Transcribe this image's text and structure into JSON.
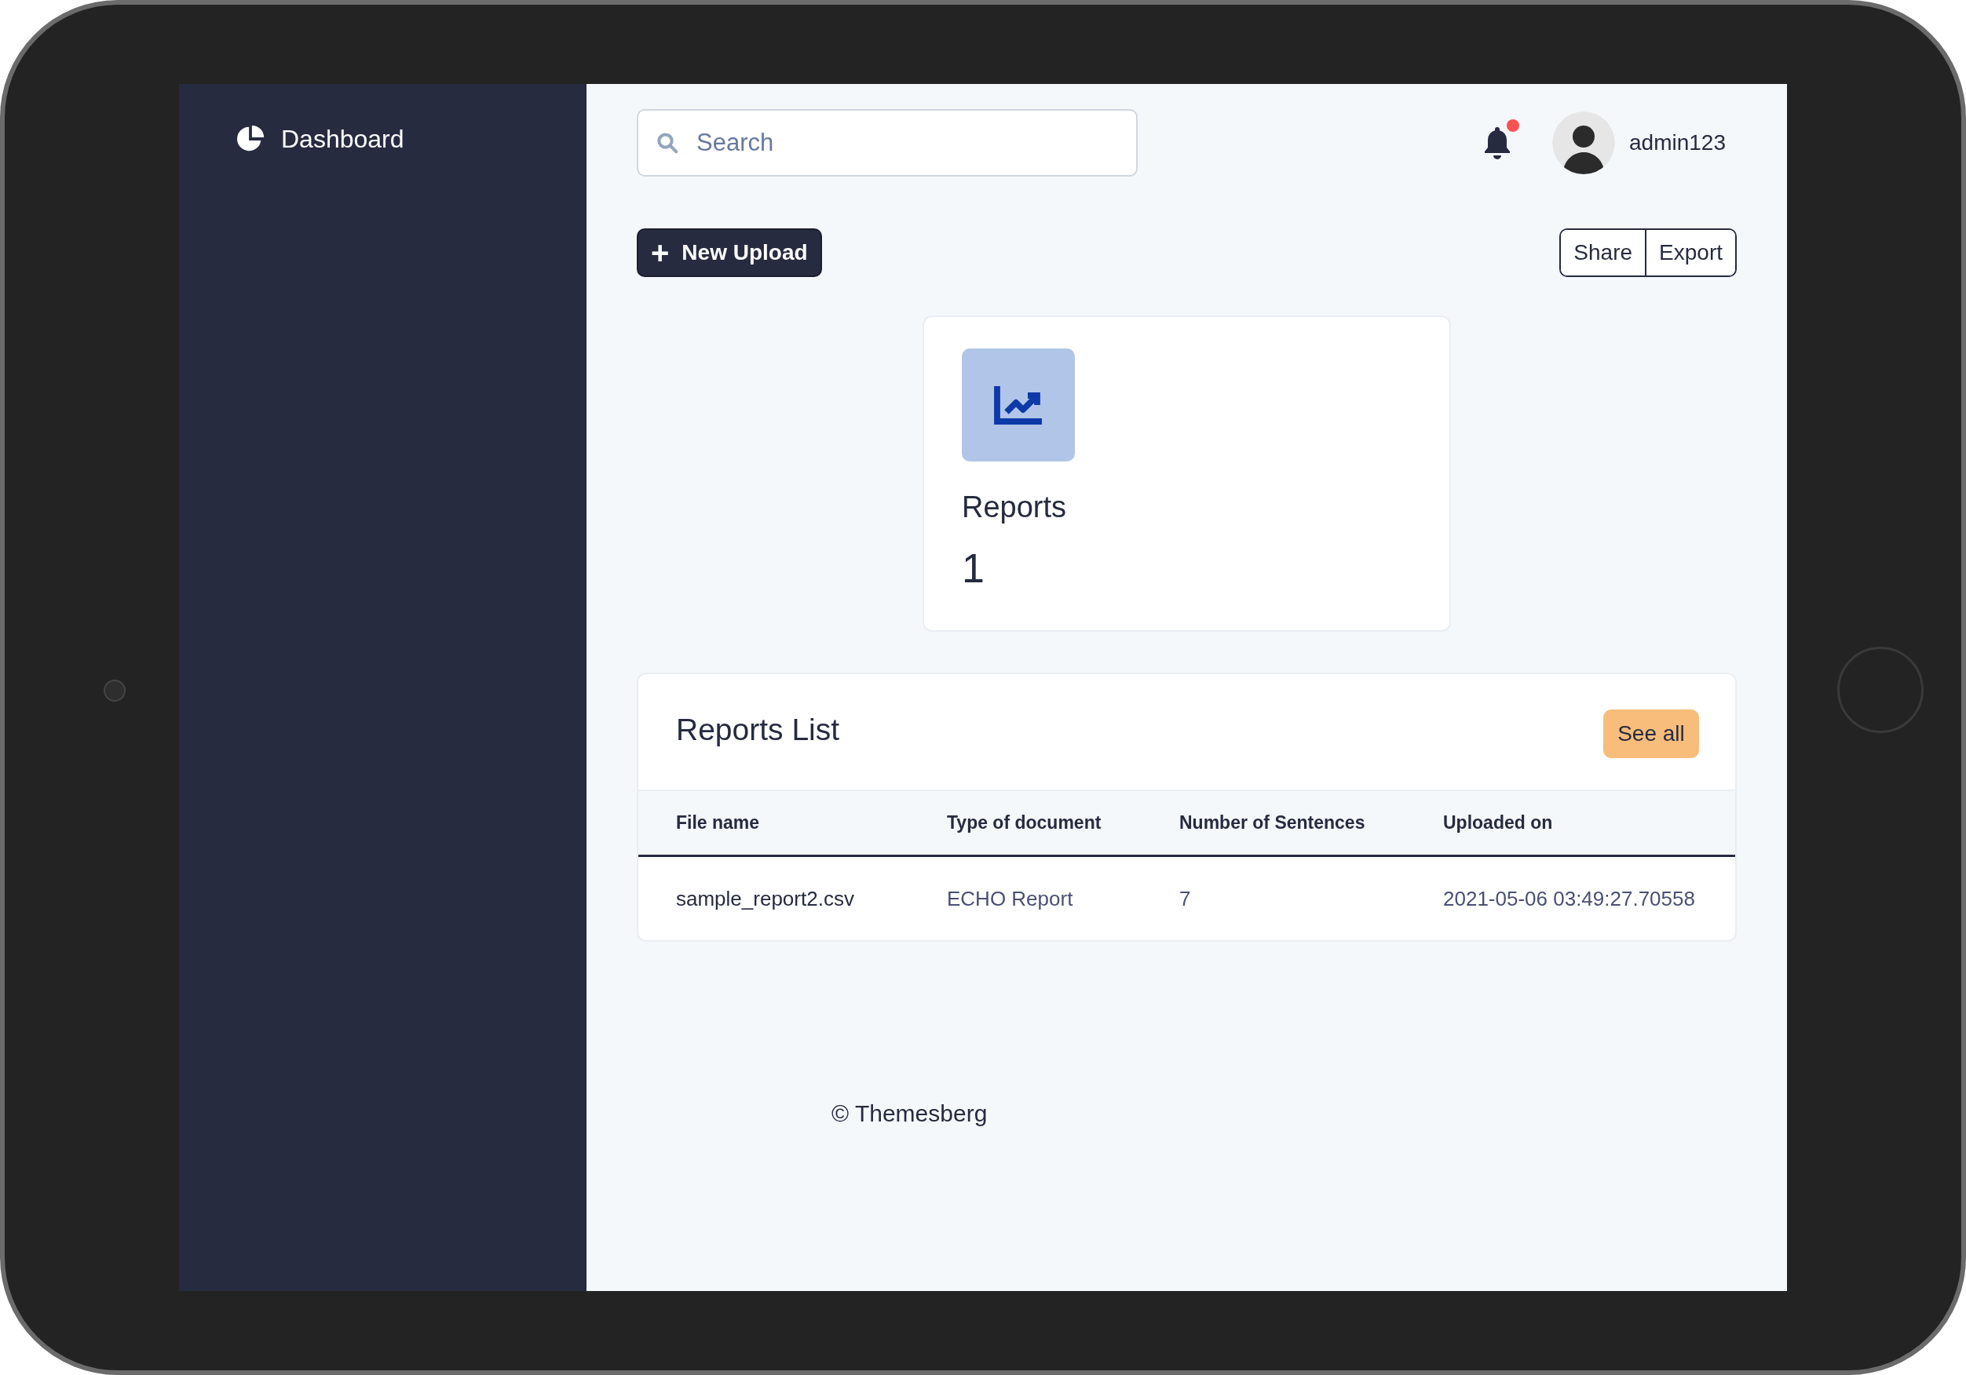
{
  "sidebar": {
    "brand": "Dashboard"
  },
  "topbar": {
    "search": {
      "placeholder": "Search"
    },
    "notifications": {
      "unread": true
    },
    "user": {
      "name": "admin123"
    }
  },
  "toolbar": {
    "primary_button": {
      "icon": "+",
      "label": "New Upload"
    },
    "button_group": [
      "Share",
      "Export"
    ]
  },
  "stat_card": {
    "label": "Reports",
    "value": "1"
  },
  "reports_list": {
    "title": "Reports List",
    "see_all": "See all",
    "columns": [
      "File name",
      "Type of document",
      "Number of Sentences",
      "Uploaded on"
    ],
    "rows": [
      [
        "sample_report2.csv",
        "ECHO Report",
        "7",
        "2021-05-06 03:49:27.70558"
      ]
    ]
  },
  "footer": "© Themesberg"
}
